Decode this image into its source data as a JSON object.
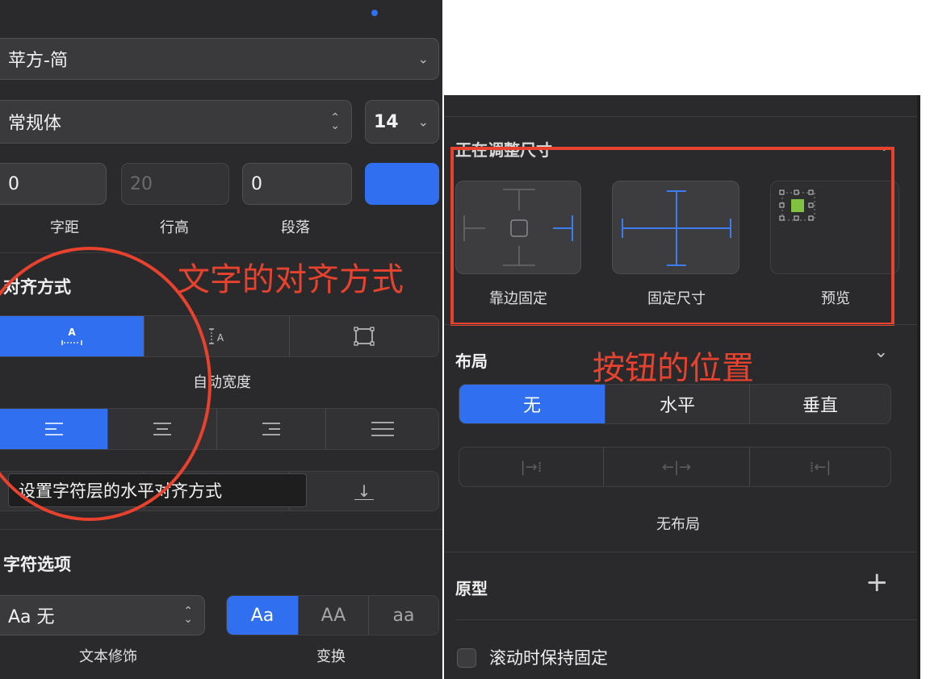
{
  "font": {
    "family_value": "苹方-简",
    "style_value": "常规体",
    "size_value": "14",
    "color_swatch": "#2f6ff0"
  },
  "spacing": {
    "letter_value": "0",
    "line_value": "20",
    "paragraph_value": "0",
    "letter_label": "字距",
    "line_label": "行高",
    "paragraph_label": "段落"
  },
  "alignment": {
    "title": "对齐方式",
    "width_options": [
      {
        "icon": "auto-width-icon",
        "glyph": "A",
        "active": true
      },
      {
        "icon": "auto-height-icon",
        "glyph": "A",
        "active": false
      },
      {
        "icon": "fixed-size-icon",
        "active": false
      }
    ],
    "width_caption": "自动宽度",
    "horizontal_options": [
      {
        "icon": "align-left-icon",
        "active": true
      },
      {
        "icon": "align-center-icon",
        "active": false
      },
      {
        "icon": "align-right-icon",
        "active": false
      },
      {
        "icon": "align-justify-icon",
        "active": false
      }
    ],
    "vertical_bottom_glyph": "↓"
  },
  "tooltip": {
    "text": "设置字符层的水平对齐方式"
  },
  "char_options": {
    "title": "字符选项",
    "decoration_value": "Aa 无",
    "decoration_label": "文本修饰",
    "transform_options": [
      "Aa",
      "AA",
      "aa"
    ],
    "transform_active": 0,
    "transform_label": "变换"
  },
  "resizing": {
    "title": "正在调整尺寸",
    "cards": [
      {
        "label": "靠边固定",
        "icon": "pin-to-edge-icon"
      },
      {
        "label": "固定尺寸",
        "icon": "fix-size-icon"
      },
      {
        "label": "预览",
        "icon": "preview-icon"
      }
    ]
  },
  "layout": {
    "title": "布局",
    "options": [
      "无",
      "水平",
      "垂直"
    ],
    "active": 0,
    "direction_glyphs": [
      "|→⁞",
      "←|→",
      "⁞←|"
    ],
    "status": "无布局"
  },
  "prototype": {
    "title": "原型",
    "add_glyph": "+"
  },
  "scroll": {
    "label": "滚动时保持固定"
  },
  "annotations": {
    "text_alignment": "文字的对齐方式",
    "button_position": "按钮的位置",
    "color": "#e8422e"
  }
}
